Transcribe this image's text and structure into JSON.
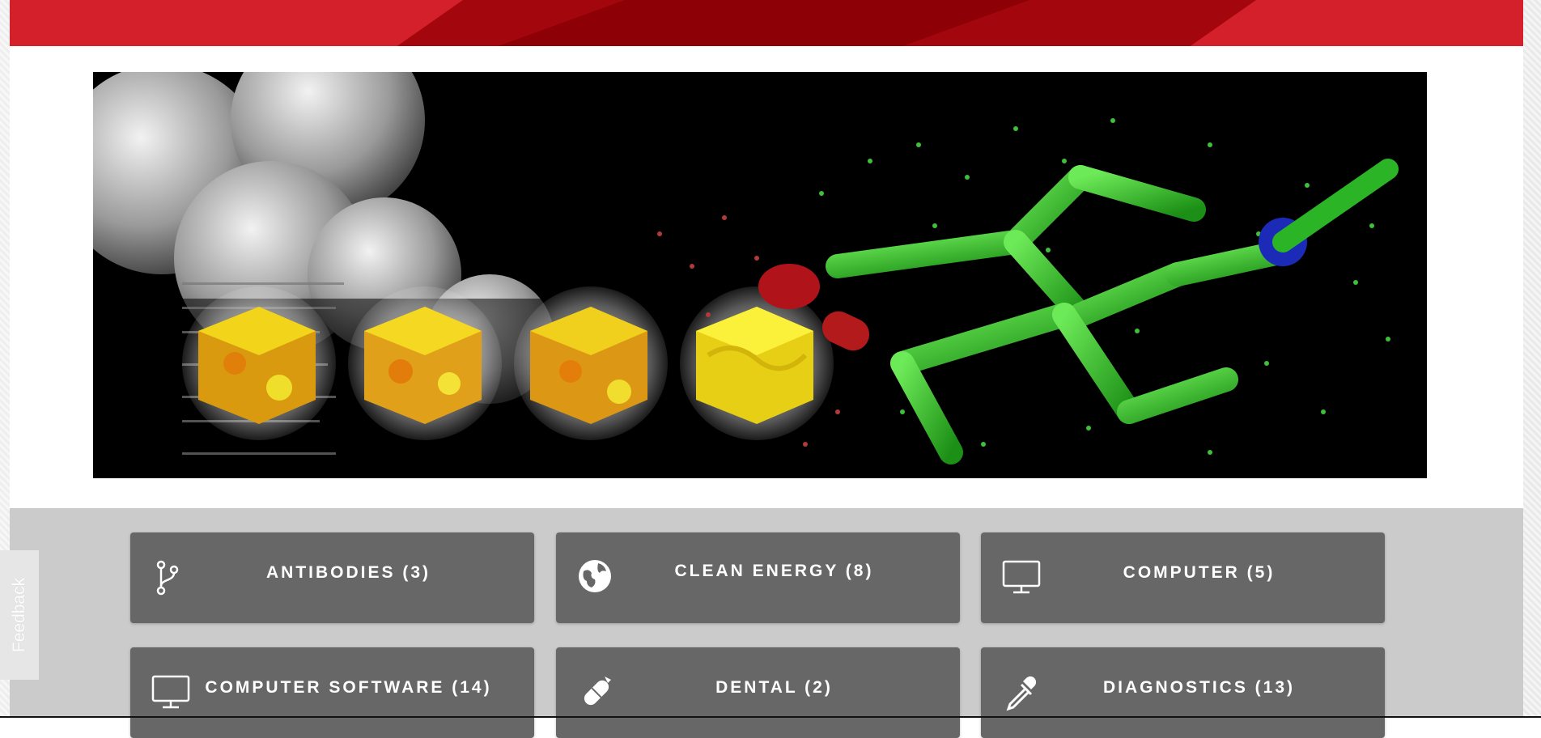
{
  "feedback": {
    "label": "Feedback"
  },
  "categories": [
    {
      "label": "ANTIBODIES (3)",
      "icon": "branch-icon"
    },
    {
      "label": "CLEAN ENERGY (8)",
      "icon": "globe-icon"
    },
    {
      "label": "COMPUTER (5)",
      "icon": "monitor-icon"
    },
    {
      "label": "COMPUTER SOFTWARE (14)",
      "icon": "monitor-icon"
    },
    {
      "label": "DENTAL (2)",
      "icon": "pill-icon"
    },
    {
      "label": "DIAGNOSTICS (13)",
      "icon": "dropper-icon"
    }
  ],
  "colors": {
    "banner_red": "#d4202a",
    "banner_dark_red": "#a4060d",
    "tile_gray": "#676767",
    "section_gray": "#cbcbcb"
  }
}
